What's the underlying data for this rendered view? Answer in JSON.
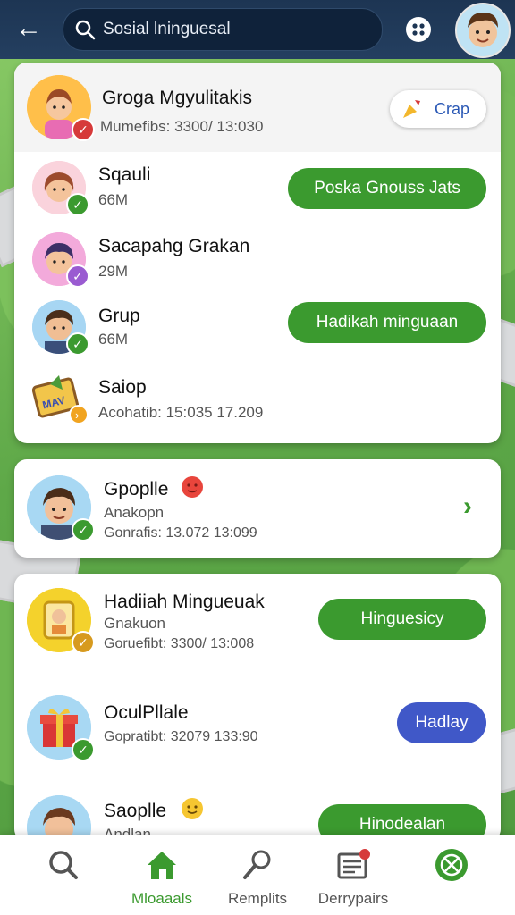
{
  "search": {
    "query": "Sosial lninguesal"
  },
  "header_card": {
    "title": "Groga Mgyulitakis",
    "subtitle": "Mumefibs: 3300/ 13:030",
    "button": "Crap"
  },
  "list_a": [
    {
      "name": "Sqauli",
      "meta": "66M",
      "action": "Poska Gnouss Jats"
    },
    {
      "name": "Sacapahg Grakan",
      "meta": "29M",
      "action": ""
    },
    {
      "name": "Grup",
      "meta": "66M",
      "action": "Hadikah minguaan"
    },
    {
      "name": "Saiop",
      "meta": "Acohatib: 15:035 17.209",
      "action": ""
    }
  ],
  "single_card": {
    "name": "Gpoplle",
    "line1": "Anakopn",
    "line2": "Gonrafis: 13.072 13:099"
  },
  "list_b": [
    {
      "name": "Hadiiah Mingueuak",
      "line1": "Gnakuon",
      "line2": "Goruefibt: 3300/ 13:008",
      "action": "Hinguesicy"
    },
    {
      "name": "OculPllale",
      "line1": "Gopratibt: 32079 133:90",
      "action": "Hadlay"
    },
    {
      "name": "Saoplle",
      "line1": "Andlan",
      "action": "Hinodealan"
    }
  ],
  "bottom_nav": [
    {
      "label": "",
      "icon": "search-icon"
    },
    {
      "label": "Mloaaals",
      "icon": "home-icon"
    },
    {
      "label": "Remplits",
      "icon": "microphone-icon"
    },
    {
      "label": "Derrypairs",
      "icon": "news-icon"
    },
    {
      "label": "",
      "icon": "close-circle-icon"
    }
  ],
  "colors": {
    "accent_green": "#3b9a2f",
    "accent_blue": "#4058c8",
    "topbar": "#1d3553"
  }
}
